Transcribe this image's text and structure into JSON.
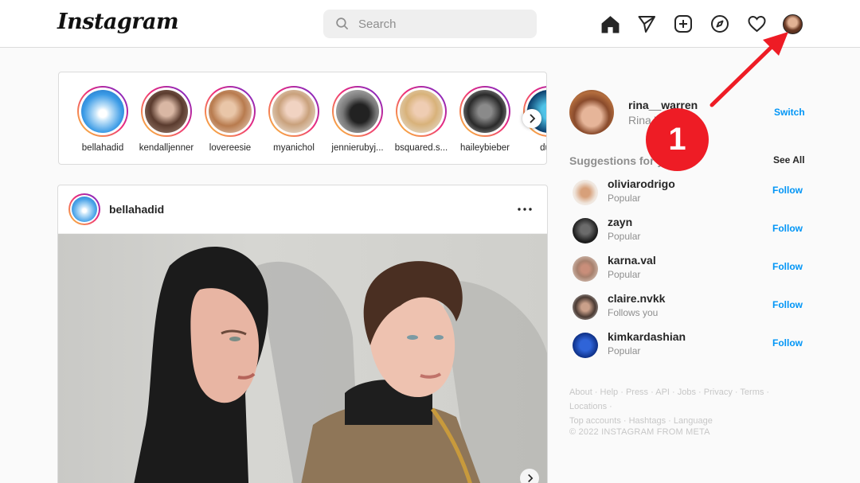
{
  "header": {
    "logo": "Instagram",
    "search_placeholder": "Search",
    "icons": [
      "home-icon",
      "direct-message-icon",
      "new-post-icon",
      "explore-icon",
      "activity-heart-icon",
      "profile-avatar"
    ]
  },
  "stories": [
    {
      "name": "bellahadid"
    },
    {
      "name": "kendalljenner"
    },
    {
      "name": "lovereesie"
    },
    {
      "name": "myanichol"
    },
    {
      "name": "jennierubyj..."
    },
    {
      "name": "bsquared.s..."
    },
    {
      "name": "haileybieber"
    },
    {
      "name": "dual"
    }
  ],
  "post": {
    "username": "bellahadid",
    "more_icon": "more-dots-icon"
  },
  "sidebar": {
    "username": "rina__warren",
    "fullname": "Rina W",
    "switch_label": "Switch",
    "suggestions_title": "Suggestions for you",
    "see_all": "See All",
    "suggestions": [
      {
        "username": "oliviarodrigo",
        "sub": "Popular",
        "action": "Follow"
      },
      {
        "username": "zayn",
        "sub": "Popular",
        "action": "Follow"
      },
      {
        "username": "karna.val",
        "sub": "Popular",
        "action": "Follow"
      },
      {
        "username": "claire.nvkk",
        "sub": "Follows you",
        "action": "Follow"
      },
      {
        "username": "kimkardashian",
        "sub": "Popular",
        "action": "Follow"
      }
    ],
    "footer_links": [
      "About",
      "Help",
      "Press",
      "API",
      "Jobs",
      "Privacy",
      "Terms",
      "Locations",
      "Top accounts",
      "Hashtags",
      "Language"
    ],
    "copyright": "© 2022 INSTAGRAM FROM META"
  },
  "annotation": {
    "step_number": "1",
    "color": "#ee1c25"
  },
  "colors": {
    "link_blue": "#0095f6",
    "muted_text": "#8e8e8e",
    "border": "#dbdbdb"
  }
}
